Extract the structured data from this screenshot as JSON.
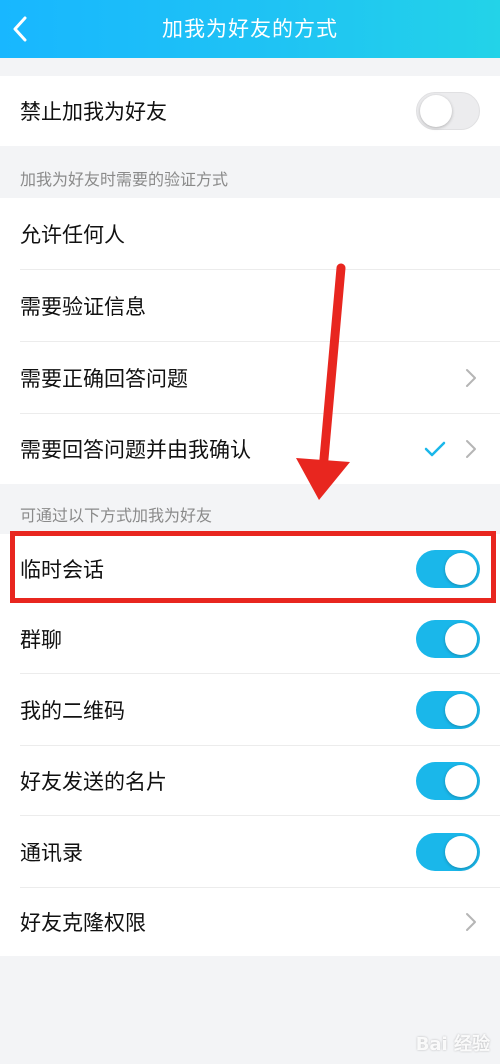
{
  "header": {
    "title": "加我为好友的方式"
  },
  "block_all": {
    "label": "禁止加我为好友",
    "enabled": false
  },
  "verify_section": {
    "title": "加我为好友时需要的验证方式",
    "options": [
      {
        "label": "允许任何人",
        "selected": false,
        "has_chevron": false
      },
      {
        "label": "需要验证信息",
        "selected": false,
        "has_chevron": false
      },
      {
        "label": "需要正确回答问题",
        "selected": false,
        "has_chevron": true
      },
      {
        "label": "需要回答问题并由我确认",
        "selected": true,
        "has_chevron": true
      }
    ]
  },
  "sources_section": {
    "title": "可通过以下方式加我为好友",
    "items": [
      {
        "label": "临时会话",
        "enabled": true
      },
      {
        "label": "群聊",
        "enabled": true
      },
      {
        "label": "我的二维码",
        "enabled": true
      },
      {
        "label": "好友发送的名片",
        "enabled": true
      },
      {
        "label": "通讯录",
        "enabled": true
      }
    ],
    "clone_permission": {
      "label": "好友克隆权限"
    }
  },
  "watermark": {
    "text": "Bai 经验"
  },
  "colors": {
    "accent": "#1ab7ea",
    "annotation": "#e8261f",
    "header_start": "#18b7ff",
    "header_end": "#23d3e8"
  }
}
